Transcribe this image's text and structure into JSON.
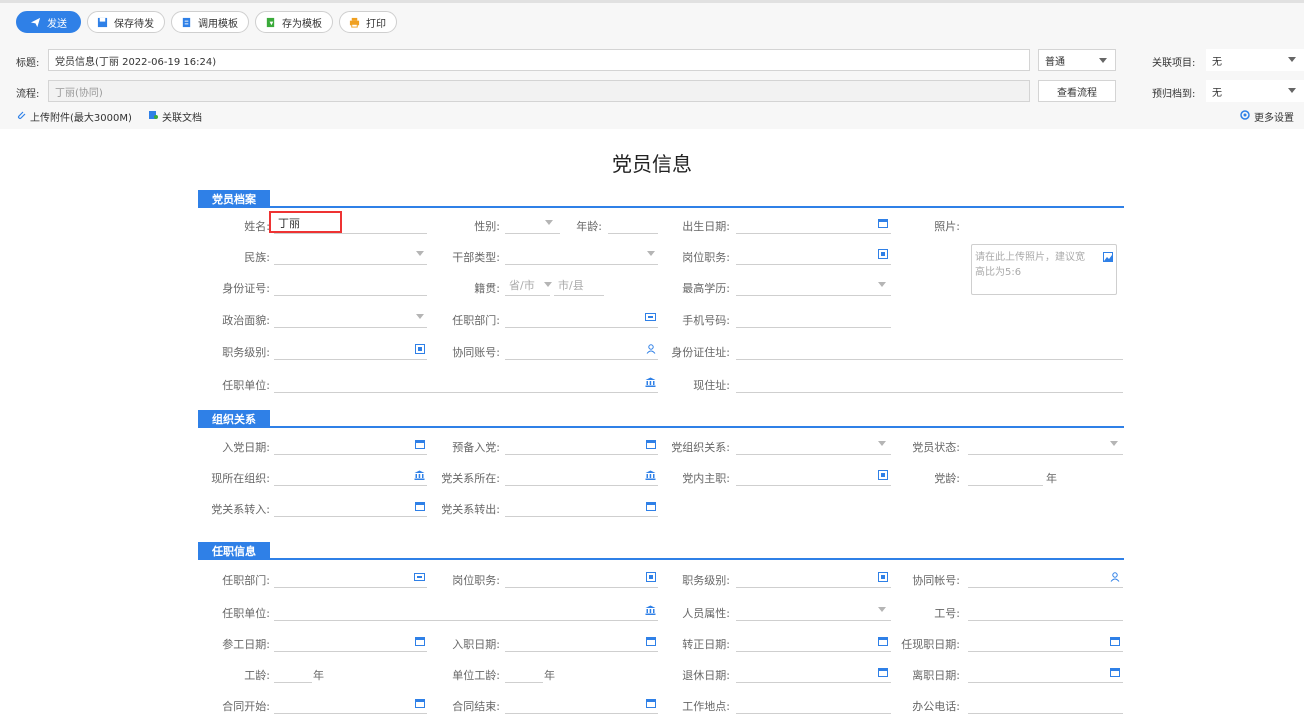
{
  "toolbar": {
    "send": "发送",
    "save_draft": "保存待发",
    "use_template": "调用模板",
    "save_template": "存为模板",
    "print": "打印"
  },
  "header": {
    "title_label": "标题:",
    "title_value": "党员信息(丁丽 2022-06-19 16:24)",
    "flow_label": "流程:",
    "flow_value": "丁丽(协同)",
    "priority_value": "普通",
    "view_flow": "查看流程",
    "related_project_label": "关联项目:",
    "related_project_value": "无",
    "archive_label": "预归档到:",
    "archive_value": "无",
    "upload_attachment": "上传附件(最大3000M)",
    "related_doc": "关联文档",
    "more_settings": "更多设置"
  },
  "form": {
    "title": "党员信息",
    "sections": {
      "archive": "党员档案",
      "org": "组织关系",
      "job": "任职信息"
    },
    "labels": {
      "name": "姓名:",
      "gender": "性别:",
      "age": "年龄:",
      "birth": "出生日期:",
      "photo": "照片:",
      "ethnic": "民族:",
      "cadre_type": "干部类型:",
      "post": "岗位职务:",
      "id_no": "身份证号:",
      "native": "籍贯:",
      "education": "最高学历:",
      "political": "政治面貌:",
      "dept": "任职部门:",
      "mobile": "手机号码:",
      "level": "职务级别:",
      "account": "协同账号:",
      "id_addr": "身份证住址:",
      "unit": "任职单位:",
      "addr": "现住址:",
      "join_date": "入党日期:",
      "prep_date": "预备入党:",
      "party_rel": "党组织关系:",
      "party_status": "党员状态:",
      "cur_org": "现所在组织:",
      "rel_loc": "党关系所在:",
      "party_post": "党内主职:",
      "party_age": "党龄:",
      "rel_in": "党关系转入:",
      "rel_out": "党关系转出:",
      "j_dept": "任职部门:",
      "j_post": "岗位职务:",
      "j_level": "职务级别:",
      "j_account": "协同帐号:",
      "j_unit": "任职单位:",
      "j_attr": "人员属性:",
      "j_no": "工号:",
      "work_date": "参工日期:",
      "entry_date": "入职日期:",
      "regular_date": "转正日期:",
      "cur_job_date": "任现职日期:",
      "seniority": "工龄:",
      "unit_seniority": "单位工龄:",
      "retire_date": "退休日期:",
      "leave_date": "离职日期:",
      "contract_start": "合同开始:",
      "contract_end": "合同结束:",
      "work_place": "工作地点:",
      "office_phone": "办公电话:"
    },
    "values": {
      "name": "丁丽"
    },
    "placeholders": {
      "province": "省/市",
      "county": "市/县",
      "photo": "请在此上传照片，建议宽高比为5:6"
    },
    "units": {
      "year": "年"
    }
  },
  "colors": {
    "primary": "#2f80e7",
    "highlight": "#e33333"
  }
}
